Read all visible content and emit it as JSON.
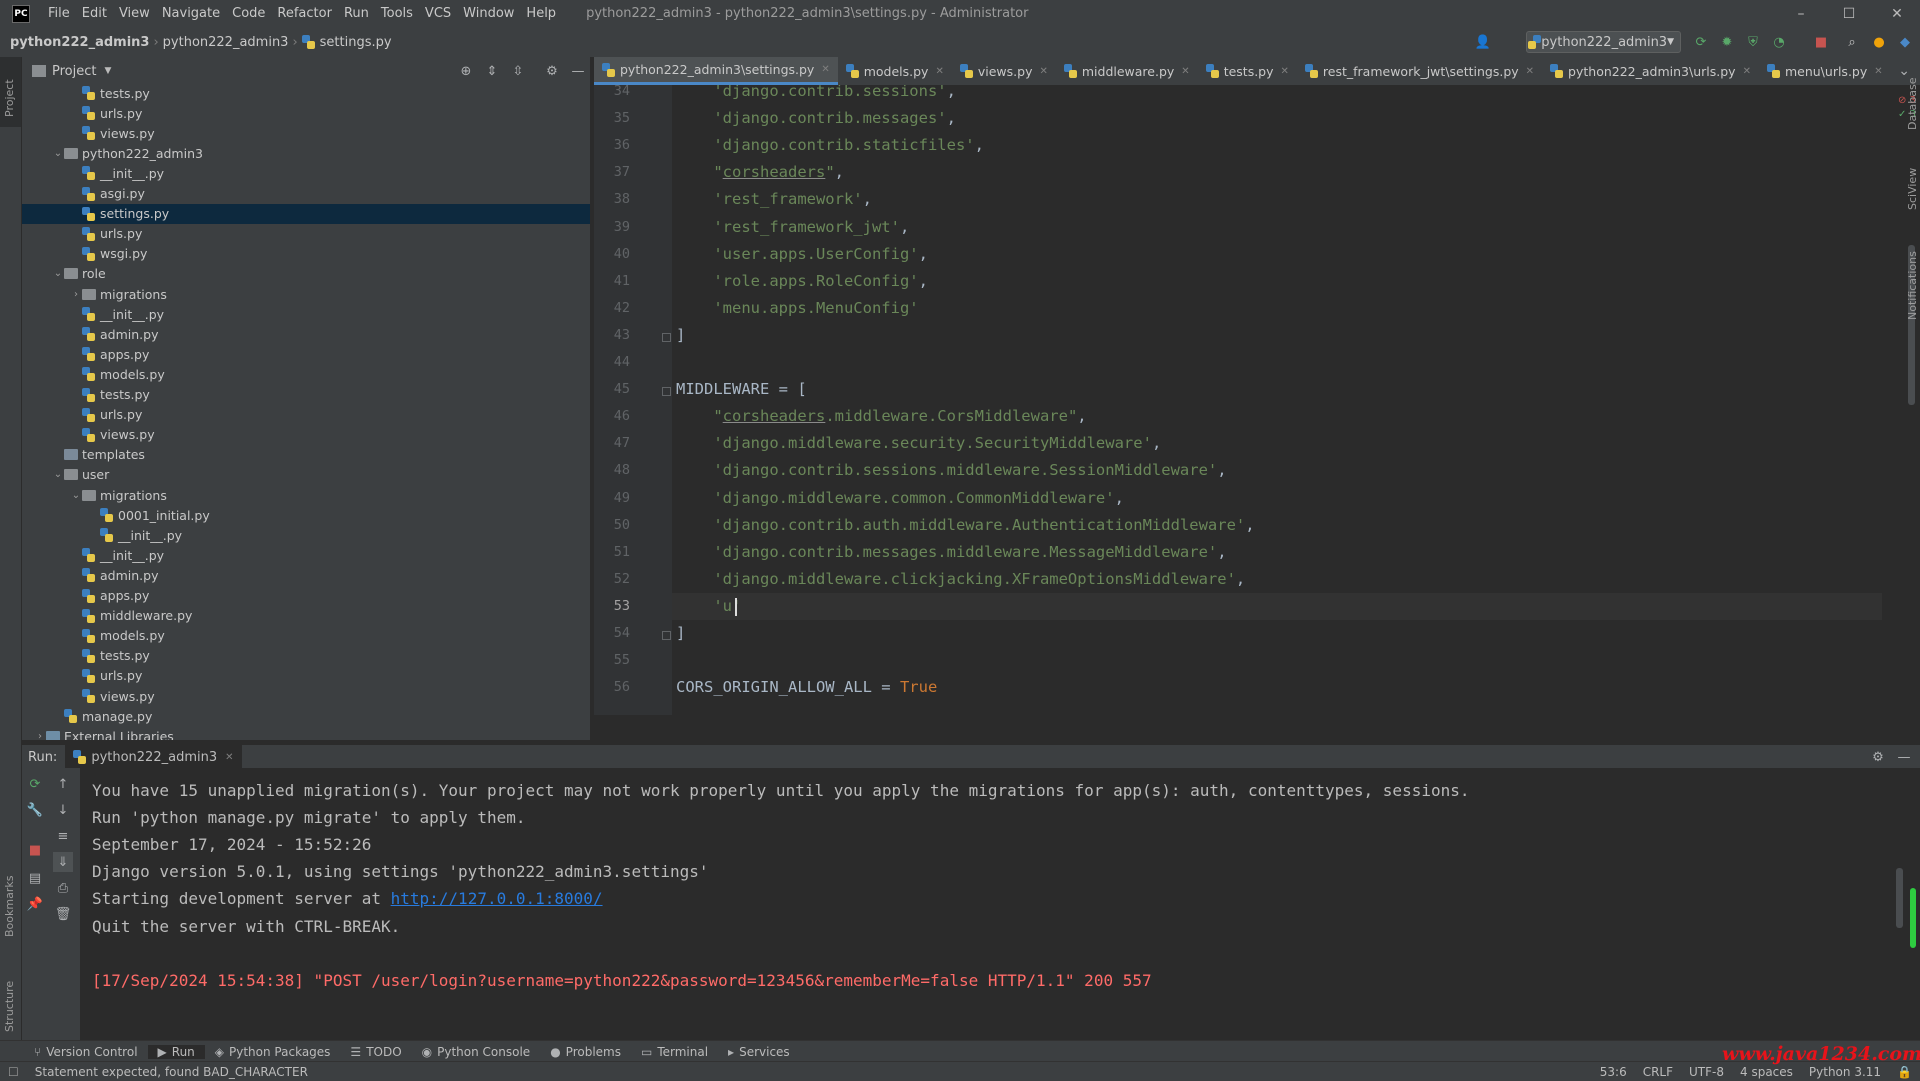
{
  "window": {
    "logo": "PC",
    "menu": [
      "File",
      "Edit",
      "View",
      "Navigate",
      "Code",
      "Refactor",
      "Run",
      "Tools",
      "VCS",
      "Window",
      "Help"
    ],
    "title": "python222_admin3 - python222_admin3\\settings.py - Administrator",
    "controls": {
      "minimize": "–",
      "maximize": "☐",
      "close": "✕"
    }
  },
  "navbar": {
    "breadcrumbs": [
      "python222_admin3",
      "python222_admin3",
      "settings.py"
    ],
    "run_config": "python222_admin3"
  },
  "left_stripe": {
    "project": "Project",
    "bookmarks": "Bookmarks",
    "structure": "Structure"
  },
  "right_stripe": {
    "database": "Database",
    "sciview": "SciView",
    "notifications": "Notifications"
  },
  "project_panel": {
    "title": "Project",
    "tree": [
      {
        "label": "tests.py",
        "type": "py",
        "depth": 2
      },
      {
        "label": "urls.py",
        "type": "py",
        "depth": 2
      },
      {
        "label": "views.py",
        "type": "py",
        "depth": 2
      },
      {
        "label": "python222_admin3",
        "type": "folder",
        "depth": 1,
        "expanded": true
      },
      {
        "label": "__init__.py",
        "type": "py",
        "depth": 2
      },
      {
        "label": "asgi.py",
        "type": "py",
        "depth": 2
      },
      {
        "label": "settings.py",
        "type": "py",
        "depth": 2,
        "selected": true
      },
      {
        "label": "urls.py",
        "type": "py",
        "depth": 2
      },
      {
        "label": "wsgi.py",
        "type": "py",
        "depth": 2
      },
      {
        "label": "role",
        "type": "folder",
        "depth": 1,
        "expanded": true
      },
      {
        "label": "migrations",
        "type": "folder",
        "depth": 2,
        "expanded": false
      },
      {
        "label": "__init__.py",
        "type": "py",
        "depth": 2
      },
      {
        "label": "admin.py",
        "type": "py",
        "depth": 2
      },
      {
        "label": "apps.py",
        "type": "py",
        "depth": 2
      },
      {
        "label": "models.py",
        "type": "py",
        "depth": 2
      },
      {
        "label": "tests.py",
        "type": "py",
        "depth": 2
      },
      {
        "label": "urls.py",
        "type": "py",
        "depth": 2
      },
      {
        "label": "views.py",
        "type": "py",
        "depth": 2
      },
      {
        "label": "templates",
        "type": "folder-plain",
        "depth": 1
      },
      {
        "label": "user",
        "type": "folder",
        "depth": 1,
        "expanded": true
      },
      {
        "label": "migrations",
        "type": "folder",
        "depth": 2,
        "expanded": true
      },
      {
        "label": "0001_initial.py",
        "type": "py",
        "depth": 3
      },
      {
        "label": "__init__.py",
        "type": "py",
        "depth": 3
      },
      {
        "label": "__init__.py",
        "type": "py",
        "depth": 2
      },
      {
        "label": "admin.py",
        "type": "py",
        "depth": 2
      },
      {
        "label": "apps.py",
        "type": "py",
        "depth": 2
      },
      {
        "label": "middleware.py",
        "type": "py",
        "depth": 2
      },
      {
        "label": "models.py",
        "type": "py",
        "depth": 2
      },
      {
        "label": "tests.py",
        "type": "py",
        "depth": 2
      },
      {
        "label": "urls.py",
        "type": "py",
        "depth": 2
      },
      {
        "label": "views.py",
        "type": "py",
        "depth": 2
      },
      {
        "label": "manage.py",
        "type": "py",
        "depth": 1
      },
      {
        "label": "External Libraries",
        "type": "lib",
        "depth": 0,
        "expanded": false
      }
    ]
  },
  "editor": {
    "tabs": [
      {
        "label": "python222_admin3\\settings.py",
        "active": true
      },
      {
        "label": "models.py"
      },
      {
        "label": "views.py"
      },
      {
        "label": "middleware.py"
      },
      {
        "label": "tests.py"
      },
      {
        "label": "rest_framework_jwt\\settings.py"
      },
      {
        "label": "python222_admin3\\urls.py"
      },
      {
        "label": "menu\\urls.py"
      }
    ],
    "inspection": {
      "errors": "3",
      "warnings": "3"
    },
    "current_line": 53,
    "lines": [
      {
        "n": 34,
        "tokens": [
          [
            "    ",
            ""
          ],
          [
            "'django.contrib.sessions'",
            "str"
          ],
          [
            ",",
            ""
          ]
        ]
      },
      {
        "n": 35,
        "tokens": [
          [
            "    ",
            ""
          ],
          [
            "'django.contrib.messages'",
            "str"
          ],
          [
            ",",
            ""
          ]
        ]
      },
      {
        "n": 36,
        "tokens": [
          [
            "    ",
            ""
          ],
          [
            "'django.contrib.staticfiles'",
            "str"
          ],
          [
            ",",
            ""
          ]
        ]
      },
      {
        "n": 37,
        "tokens": [
          [
            "    ",
            ""
          ],
          [
            "\"",
            "str"
          ],
          [
            "corsheaders",
            "str ul"
          ],
          [
            "\"",
            "str"
          ],
          [
            ",",
            ""
          ]
        ]
      },
      {
        "n": 38,
        "tokens": [
          [
            "    ",
            ""
          ],
          [
            "'rest_framework'",
            "str"
          ],
          [
            ",",
            ""
          ]
        ]
      },
      {
        "n": 39,
        "tokens": [
          [
            "    ",
            ""
          ],
          [
            "'rest_framework_jwt'",
            "str"
          ],
          [
            ",",
            ""
          ]
        ]
      },
      {
        "n": 40,
        "tokens": [
          [
            "    ",
            ""
          ],
          [
            "'user.apps.UserConfig'",
            "str"
          ],
          [
            ",",
            ""
          ]
        ]
      },
      {
        "n": 41,
        "tokens": [
          [
            "    ",
            ""
          ],
          [
            "'role.apps.RoleConfig'",
            "str"
          ],
          [
            ",",
            ""
          ]
        ]
      },
      {
        "n": 42,
        "tokens": [
          [
            "    ",
            ""
          ],
          [
            "'menu.apps.MenuConfig'",
            "str"
          ]
        ]
      },
      {
        "n": 43,
        "tokens": [
          [
            "]",
            ""
          ]
        ]
      },
      {
        "n": 44,
        "tokens": []
      },
      {
        "n": 45,
        "tokens": [
          [
            "MIDDLEWARE = [",
            ""
          ]
        ]
      },
      {
        "n": 46,
        "tokens": [
          [
            "    ",
            ""
          ],
          [
            "\"",
            "str"
          ],
          [
            "corsheaders",
            "str ul"
          ],
          [
            ".middleware.CorsMiddleware\"",
            "str"
          ],
          [
            ",",
            ""
          ]
        ]
      },
      {
        "n": 47,
        "tokens": [
          [
            "    ",
            ""
          ],
          [
            "'django.middleware.security.SecurityMiddleware'",
            "str"
          ],
          [
            ",",
            ""
          ]
        ]
      },
      {
        "n": 48,
        "tokens": [
          [
            "    ",
            ""
          ],
          [
            "'django.contrib.sessions.middleware.SessionMiddleware'",
            "str"
          ],
          [
            ",",
            ""
          ]
        ]
      },
      {
        "n": 49,
        "tokens": [
          [
            "    ",
            ""
          ],
          [
            "'django.middleware.common.CommonMiddleware'",
            "str"
          ],
          [
            ",",
            ""
          ]
        ]
      },
      {
        "n": 50,
        "tokens": [
          [
            "    ",
            ""
          ],
          [
            "'django.contrib.auth.middleware.AuthenticationMiddleware'",
            "str"
          ],
          [
            ",",
            ""
          ]
        ]
      },
      {
        "n": 51,
        "tokens": [
          [
            "    ",
            ""
          ],
          [
            "'django.contrib.messages.middleware.MessageMiddleware'",
            "str"
          ],
          [
            ",",
            ""
          ]
        ]
      },
      {
        "n": 52,
        "tokens": [
          [
            "    ",
            ""
          ],
          [
            "'django.middleware.clickjacking.XFrameOptionsMiddleware'",
            "str"
          ],
          [
            ",",
            ""
          ]
        ]
      },
      {
        "n": 53,
        "tokens": [
          [
            "    ",
            ""
          ],
          [
            "'u'",
            "str"
          ]
        ]
      },
      {
        "n": 54,
        "tokens": [
          [
            "]",
            ""
          ]
        ]
      },
      {
        "n": 55,
        "tokens": []
      },
      {
        "n": 56,
        "tokens": [
          [
            "CORS_ORIGIN_ALLOW_ALL = ",
            ""
          ],
          [
            "True",
            "kw"
          ]
        ]
      }
    ]
  },
  "run_panel": {
    "label": "Run:",
    "tab": "python222_admin3",
    "console": [
      {
        "text": "You have 15 unapplied migration(s). Your project may not work properly until you apply the migrations for app(s): auth, contenttypes, sessions.",
        "kind": "normal"
      },
      {
        "text": "Run 'python manage.py migrate' to apply them.",
        "kind": "normal"
      },
      {
        "text": "September 17, 2024 - 15:52:26",
        "kind": "normal"
      },
      {
        "text": "Django version 5.0.1, using settings 'python222_admin3.settings'",
        "kind": "normal"
      },
      {
        "text": "Starting development server at ",
        "kind": "normal",
        "link": "http://127.0.0.1:8000/"
      },
      {
        "text": "Quit the server with CTRL-BREAK.",
        "kind": "normal"
      },
      {
        "text": "",
        "kind": "normal"
      },
      {
        "text": "[17/Sep/2024 15:54:38] \"POST /user/login?username=python222&password=123456&rememberMe=false HTTP/1.1\" 200 557",
        "kind": "err"
      }
    ]
  },
  "tool_tabs": [
    "Version Control",
    "Run",
    "Python Packages",
    "TODO",
    "Python Console",
    "Problems",
    "Terminal",
    "Services"
  ],
  "status": {
    "message": "Statement expected, found BAD_CHARACTER",
    "position": "53:6",
    "line_sep": "CRLF",
    "encoding": "UTF-8",
    "indent": "4 spaces",
    "interpreter": "Python 3.11"
  },
  "watermark": "www.java1234.com"
}
